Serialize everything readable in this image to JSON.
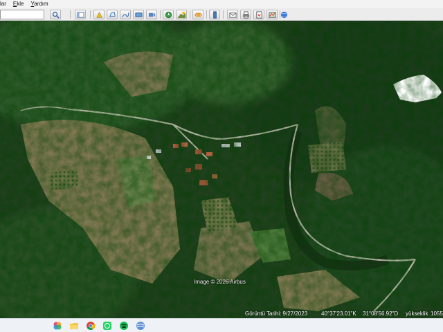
{
  "menu": {
    "items": [
      {
        "label": "lar",
        "accel": ""
      },
      {
        "label": "Ekle",
        "accel": "E"
      },
      {
        "label": "Yardım",
        "accel": "Y"
      }
    ]
  },
  "toolbar": {
    "search_value": "",
    "icons": [
      "search-icon",
      "sidebar-icon",
      "placemark-icon",
      "polygon-icon",
      "path-icon",
      "overlay-icon",
      "tour-icon",
      "history-icon",
      "sun-icon",
      "planets-icon",
      "ruler-icon",
      "email-icon",
      "print-icon",
      "save-image-icon",
      "maps-icon",
      "web-icon"
    ]
  },
  "map": {
    "attribution": "Image © 2026 Airbus",
    "imagery_date_label": "Görüntü Tarihi: 9/27/2023",
    "latitude": "40°37'23.01\"K",
    "longitude": "31°08'56.92\"D",
    "elevation_label": "yükseklik",
    "elevation_value": "1055"
  },
  "taskbar": {
    "icons": [
      "photos-icon",
      "file-explorer-icon",
      "chrome-icon",
      "whatsapp-icon",
      "spotify-icon",
      "google-earth-icon"
    ]
  },
  "colors": {
    "forest_dark": "#1f3d1c",
    "forest_mid": "#2f5a2a",
    "field_brown": "#8a7d57",
    "road": "#c9c5b7"
  }
}
